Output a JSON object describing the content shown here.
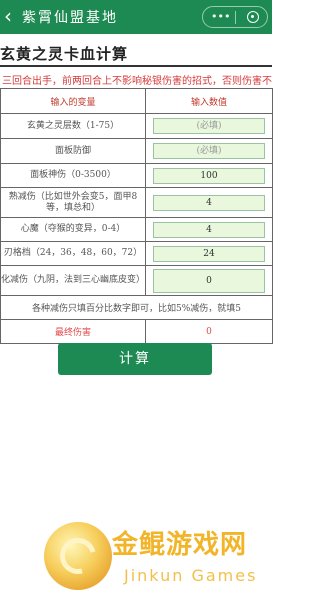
{
  "header": {
    "back_icon": "chevron-left-icon",
    "title": "紫霄仙盟基地",
    "capsule": {
      "more_label": "•••",
      "record_icon": "target-icon"
    }
  },
  "page": {
    "heading": "玄黄之灵卡血计算",
    "note": "三回合出手，前两回合上不影响秘银伤害的招式，否则伤害不"
  },
  "table": {
    "headers": {
      "variable": "输入的变量",
      "value": "输入数值"
    },
    "rows": [
      {
        "label": "玄黄之灵层数（1-75）",
        "value": "",
        "placeholder": "(必填)"
      },
      {
        "label": "面板防御",
        "value": "",
        "placeholder": "(必填)"
      },
      {
        "label": "面板神伤（0-3500）",
        "value": "100",
        "placeholder": ""
      },
      {
        "label": "熟减伤（比如世外会变5，面甲8等，填总和）",
        "value": "4",
        "placeholder": ""
      },
      {
        "label": "心魔（夺猴的变异，0-4）",
        "value": "4",
        "placeholder": ""
      },
      {
        "label": "刃格档（24，36，48，60，72）",
        "value": "24",
        "placeholder": ""
      },
      {
        "label": "化减伤（九阴，法到三心幽底皮变）",
        "value": "0",
        "placeholder": ""
      }
    ],
    "footnote": "各种减伤只填百分比数字即可，比如5%减伤，就填5",
    "result": {
      "label": "最终伤害",
      "value": "0"
    }
  },
  "actions": {
    "calculate_label": "计算"
  },
  "watermark": {
    "title": "金鲲游戏网",
    "subtitle": "Jinkun Games"
  },
  "colors": {
    "brand_green": "#1c8a52",
    "input_fill": "#e9f7dc",
    "accent_red": "#e24a4a",
    "watermark_gold": "#f2b52a"
  }
}
